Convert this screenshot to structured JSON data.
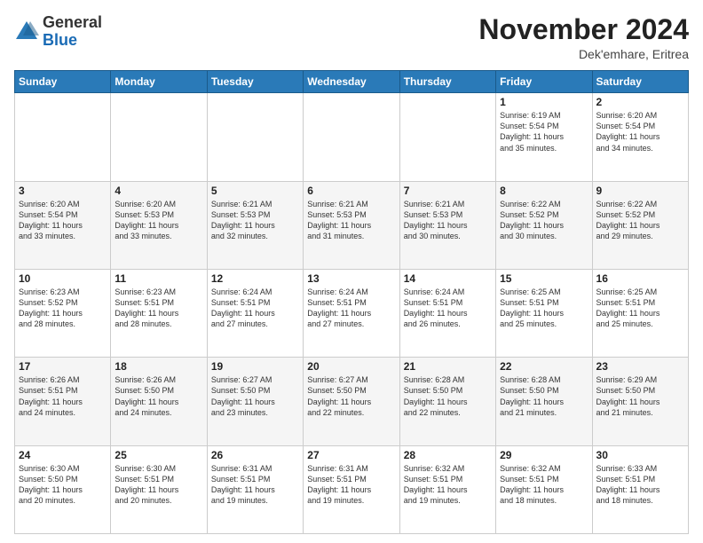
{
  "logo": {
    "general": "General",
    "blue": "Blue"
  },
  "header": {
    "month": "November 2024",
    "location": "Dek'emhare, Eritrea"
  },
  "weekdays": [
    "Sunday",
    "Monday",
    "Tuesday",
    "Wednesday",
    "Thursday",
    "Friday",
    "Saturday"
  ],
  "weeks": [
    [
      {
        "day": "",
        "info": ""
      },
      {
        "day": "",
        "info": ""
      },
      {
        "day": "",
        "info": ""
      },
      {
        "day": "",
        "info": ""
      },
      {
        "day": "",
        "info": ""
      },
      {
        "day": "1",
        "info": "Sunrise: 6:19 AM\nSunset: 5:54 PM\nDaylight: 11 hours\nand 35 minutes."
      },
      {
        "day": "2",
        "info": "Sunrise: 6:20 AM\nSunset: 5:54 PM\nDaylight: 11 hours\nand 34 minutes."
      }
    ],
    [
      {
        "day": "3",
        "info": "Sunrise: 6:20 AM\nSunset: 5:54 PM\nDaylight: 11 hours\nand 33 minutes."
      },
      {
        "day": "4",
        "info": "Sunrise: 6:20 AM\nSunset: 5:53 PM\nDaylight: 11 hours\nand 33 minutes."
      },
      {
        "day": "5",
        "info": "Sunrise: 6:21 AM\nSunset: 5:53 PM\nDaylight: 11 hours\nand 32 minutes."
      },
      {
        "day": "6",
        "info": "Sunrise: 6:21 AM\nSunset: 5:53 PM\nDaylight: 11 hours\nand 31 minutes."
      },
      {
        "day": "7",
        "info": "Sunrise: 6:21 AM\nSunset: 5:53 PM\nDaylight: 11 hours\nand 30 minutes."
      },
      {
        "day": "8",
        "info": "Sunrise: 6:22 AM\nSunset: 5:52 PM\nDaylight: 11 hours\nand 30 minutes."
      },
      {
        "day": "9",
        "info": "Sunrise: 6:22 AM\nSunset: 5:52 PM\nDaylight: 11 hours\nand 29 minutes."
      }
    ],
    [
      {
        "day": "10",
        "info": "Sunrise: 6:23 AM\nSunset: 5:52 PM\nDaylight: 11 hours\nand 28 minutes."
      },
      {
        "day": "11",
        "info": "Sunrise: 6:23 AM\nSunset: 5:51 PM\nDaylight: 11 hours\nand 28 minutes."
      },
      {
        "day": "12",
        "info": "Sunrise: 6:24 AM\nSunset: 5:51 PM\nDaylight: 11 hours\nand 27 minutes."
      },
      {
        "day": "13",
        "info": "Sunrise: 6:24 AM\nSunset: 5:51 PM\nDaylight: 11 hours\nand 27 minutes."
      },
      {
        "day": "14",
        "info": "Sunrise: 6:24 AM\nSunset: 5:51 PM\nDaylight: 11 hours\nand 26 minutes."
      },
      {
        "day": "15",
        "info": "Sunrise: 6:25 AM\nSunset: 5:51 PM\nDaylight: 11 hours\nand 25 minutes."
      },
      {
        "day": "16",
        "info": "Sunrise: 6:25 AM\nSunset: 5:51 PM\nDaylight: 11 hours\nand 25 minutes."
      }
    ],
    [
      {
        "day": "17",
        "info": "Sunrise: 6:26 AM\nSunset: 5:51 PM\nDaylight: 11 hours\nand 24 minutes."
      },
      {
        "day": "18",
        "info": "Sunrise: 6:26 AM\nSunset: 5:50 PM\nDaylight: 11 hours\nand 24 minutes."
      },
      {
        "day": "19",
        "info": "Sunrise: 6:27 AM\nSunset: 5:50 PM\nDaylight: 11 hours\nand 23 minutes."
      },
      {
        "day": "20",
        "info": "Sunrise: 6:27 AM\nSunset: 5:50 PM\nDaylight: 11 hours\nand 22 minutes."
      },
      {
        "day": "21",
        "info": "Sunrise: 6:28 AM\nSunset: 5:50 PM\nDaylight: 11 hours\nand 22 minutes."
      },
      {
        "day": "22",
        "info": "Sunrise: 6:28 AM\nSunset: 5:50 PM\nDaylight: 11 hours\nand 21 minutes."
      },
      {
        "day": "23",
        "info": "Sunrise: 6:29 AM\nSunset: 5:50 PM\nDaylight: 11 hours\nand 21 minutes."
      }
    ],
    [
      {
        "day": "24",
        "info": "Sunrise: 6:30 AM\nSunset: 5:50 PM\nDaylight: 11 hours\nand 20 minutes."
      },
      {
        "day": "25",
        "info": "Sunrise: 6:30 AM\nSunset: 5:51 PM\nDaylight: 11 hours\nand 20 minutes."
      },
      {
        "day": "26",
        "info": "Sunrise: 6:31 AM\nSunset: 5:51 PM\nDaylight: 11 hours\nand 19 minutes."
      },
      {
        "day": "27",
        "info": "Sunrise: 6:31 AM\nSunset: 5:51 PM\nDaylight: 11 hours\nand 19 minutes."
      },
      {
        "day": "28",
        "info": "Sunrise: 6:32 AM\nSunset: 5:51 PM\nDaylight: 11 hours\nand 19 minutes."
      },
      {
        "day": "29",
        "info": "Sunrise: 6:32 AM\nSunset: 5:51 PM\nDaylight: 11 hours\nand 18 minutes."
      },
      {
        "day": "30",
        "info": "Sunrise: 6:33 AM\nSunset: 5:51 PM\nDaylight: 11 hours\nand 18 minutes."
      }
    ]
  ]
}
